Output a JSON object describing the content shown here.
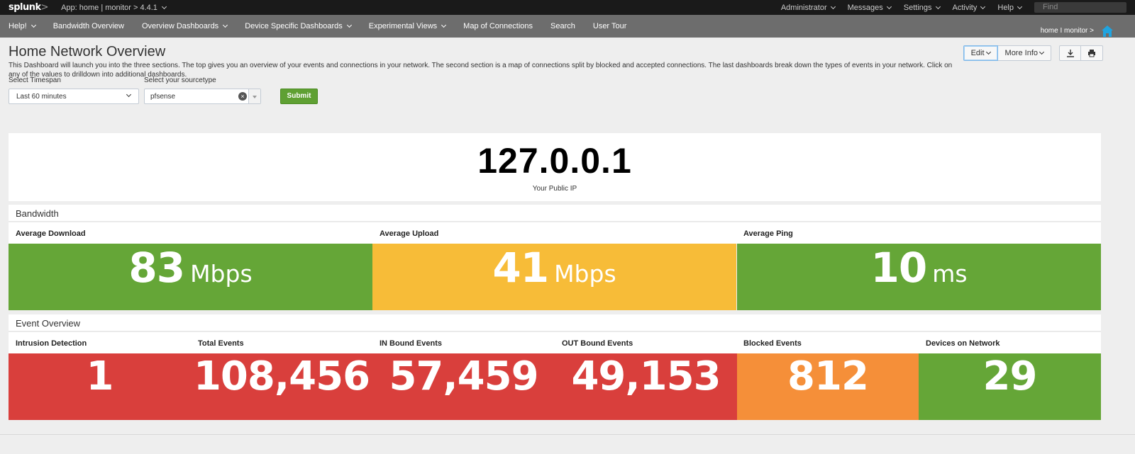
{
  "topbar": {
    "logo": "splunk",
    "logo_suffix": ">",
    "app_label": "App: home | monitor > 4.4.1",
    "menus": [
      "Administrator",
      "Messages",
      "Settings",
      "Activity",
      "Help"
    ],
    "find_placeholder": "Find"
  },
  "nav": {
    "items": [
      {
        "label": "Help!",
        "dropdown": true
      },
      {
        "label": "Bandwidth Overview",
        "dropdown": false
      },
      {
        "label": "Overview Dashboards",
        "dropdown": true
      },
      {
        "label": "Device Specific Dashboards",
        "dropdown": true
      },
      {
        "label": "Experimental Views",
        "dropdown": true
      },
      {
        "label": "Map of Connections",
        "dropdown": false
      },
      {
        "label": "Search",
        "dropdown": false
      },
      {
        "label": "User Tour",
        "dropdown": false
      }
    ],
    "app_crumb": "home I monitor >",
    "home_icon": "home-icon"
  },
  "header": {
    "title": "Home Network Overview",
    "description": "This Dashboard will launch you into the three sections. The top gives you an overview of your events and connections in your network. The second section is a map of connections split by blocked and accepted connections. The last dashboards break down the types of events in your network. Click on any of the values to drilldown into additional dashboards.",
    "edit_label": "Edit",
    "more_info_label": "More Info",
    "download_icon": "download-icon",
    "print_icon": "print-icon"
  },
  "filters": {
    "timespan_label": "Select Timespan",
    "timespan_value": "Last 60 minutes",
    "sourcetype_label": "Select your sourcetype",
    "sourcetype_value": "pfsense",
    "submit_label": "Submit"
  },
  "public_ip": {
    "value": "127.0.0.1",
    "label": "Your Public IP"
  },
  "bandwidth": {
    "title": "Bandwidth",
    "tiles": [
      {
        "label": "Average Download",
        "value": "83",
        "unit": "Mbps",
        "color": "#65a637"
      },
      {
        "label": "Average Upload",
        "value": "41",
        "unit": "Mbps",
        "color": "#f7bc38"
      },
      {
        "label": "Average Ping",
        "value": "10",
        "unit": "ms",
        "color": "#65a637"
      }
    ]
  },
  "events": {
    "title": "Event Overview",
    "tiles": [
      {
        "label": "Intrusion Detection",
        "value": "1",
        "color": "#d93f3c"
      },
      {
        "label": "Total Events",
        "value": "108,456",
        "color": "#d93f3c"
      },
      {
        "label": "IN Bound Events",
        "value": "57,459",
        "color": "#d93f3c"
      },
      {
        "label": "OUT Bound Events",
        "value": "49,153",
        "color": "#d93f3c"
      },
      {
        "label": "Blocked Events",
        "value": "812",
        "color": "#f58f39"
      },
      {
        "label": "Devices on Network",
        "value": "29",
        "color": "#65a637"
      }
    ]
  }
}
